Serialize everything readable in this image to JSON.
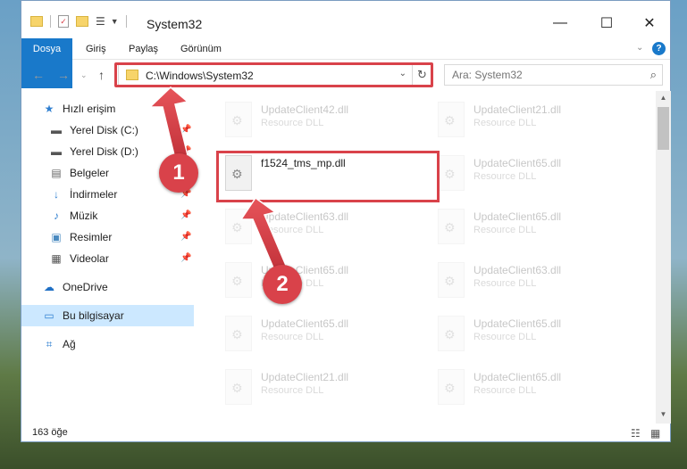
{
  "window": {
    "title": "System32"
  },
  "window_controls": {
    "minimize": "—",
    "maximize": "☐",
    "close": "✕"
  },
  "ribbon": {
    "tabs": [
      "Dosya",
      "Giriş",
      "Paylaş",
      "Görünüm"
    ]
  },
  "address": {
    "path": "C:\\Windows\\System32"
  },
  "search": {
    "placeholder": "Ara: System32"
  },
  "nav": {
    "quick_access": "Hızlı erişim",
    "items": [
      {
        "label": "Yerel Disk (C:)",
        "icon": "drive-icon",
        "pinned": true
      },
      {
        "label": "Yerel Disk (D:)",
        "icon": "drive-icon",
        "pinned": true
      },
      {
        "label": "Belgeler",
        "icon": "documents-icon",
        "pinned": true
      },
      {
        "label": "İndirmeler",
        "icon": "download-icon",
        "pinned": true
      },
      {
        "label": "Müzik",
        "icon": "music-icon",
        "pinned": true
      },
      {
        "label": "Resimler",
        "icon": "pictures-icon",
        "pinned": true
      },
      {
        "label": "Videolar",
        "icon": "videos-icon",
        "pinned": true
      }
    ],
    "onedrive": "OneDrive",
    "this_pc": "Bu bilgisayar",
    "network": "Ağ"
  },
  "files": {
    "left": [
      {
        "name": "UpdateClient42.dll",
        "type": "Resource DLL"
      },
      {
        "name": "f1524_tms_mp.dll",
        "type": ""
      },
      {
        "name": "UpdateClient63.dll",
        "type": "Resource DLL"
      },
      {
        "name": "UpdateClient65.dll",
        "type": "Resource DLL"
      },
      {
        "name": "UpdateClient65.dll",
        "type": "Resource DLL"
      },
      {
        "name": "UpdateClient21.dll",
        "type": "Resource DLL"
      }
    ],
    "right": [
      {
        "name": "UpdateClient21.dll",
        "type": "Resource DLL"
      },
      {
        "name": "UpdateClient65.dll",
        "type": "Resource DLL"
      },
      {
        "name": "UpdateClient65.dll",
        "type": "Resource DLL"
      },
      {
        "name": "UpdateClient63.dll",
        "type": "Resource DLL"
      },
      {
        "name": "UpdateClient65.dll",
        "type": "Resource DLL"
      },
      {
        "name": "UpdateClient65.dll",
        "type": "Resource DLL"
      }
    ]
  },
  "status": {
    "count": "163 öğe"
  },
  "callouts": {
    "one": "1",
    "two": "2"
  },
  "colors": {
    "accent": "#1979ca",
    "highlight": "#d9424a",
    "selection": "#cce8ff"
  }
}
